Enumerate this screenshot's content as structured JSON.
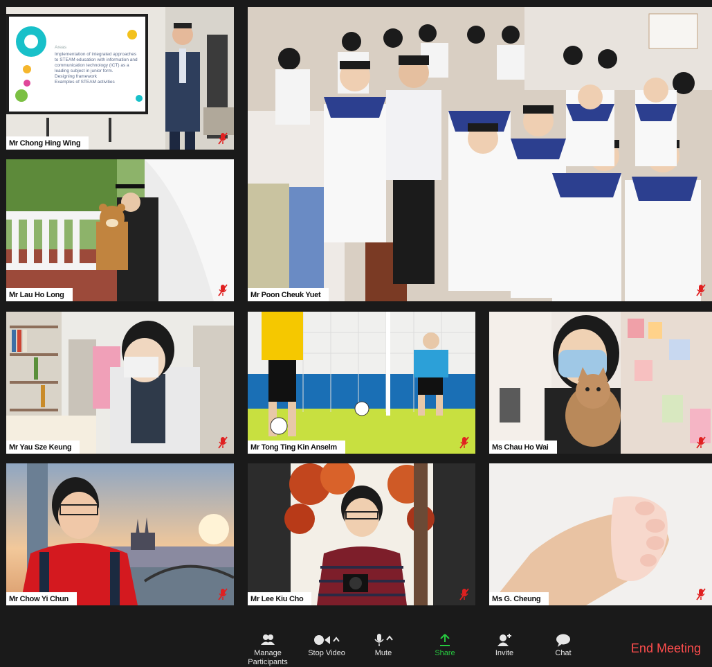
{
  "participants": [
    {
      "name": "Mr Chong Hing Wing",
      "scene": "presentation",
      "muted": true
    },
    {
      "name": "Mr Poon Cheuk Yuet",
      "scene": "class-photo",
      "muted": true
    },
    {
      "name": "Mr Lau Ho Long",
      "scene": "graduation",
      "muted": true
    },
    {
      "name": "Mr Yau Sze Keung",
      "scene": "library",
      "muted": true
    },
    {
      "name": "Mr Tong Ting Kin Anselm",
      "scene": "football",
      "muted": true
    },
    {
      "name": "Ms Chau Ho Wai",
      "scene": "cat",
      "muted": true
    },
    {
      "name": "Mr Chow Yi Chun",
      "scene": "city",
      "muted": true
    },
    {
      "name": "Mr Lee Kiu Cho",
      "scene": "autumn",
      "muted": true
    },
    {
      "name": "Ms G. Cheung",
      "scene": "baby-hand",
      "muted": true
    }
  ],
  "slide": {
    "subtitle": "Areas",
    "items": [
      "Implementation of integrated approaches to STEAM education with information and communication technology (ICT) as a leading subject in junior form.",
      "Designing framework",
      "Examples of STEAM activities"
    ]
  },
  "toolbar": {
    "manage_participants": "Manage Participants",
    "stop_video": "Stop Video",
    "mute": "Mute",
    "share": "Share",
    "invite": "Invite",
    "chat": "Chat",
    "end_meeting": "End Meeting"
  },
  "colors": {
    "share": "#27c93f",
    "end": "#ff4d4d",
    "muted": "#e02020"
  }
}
